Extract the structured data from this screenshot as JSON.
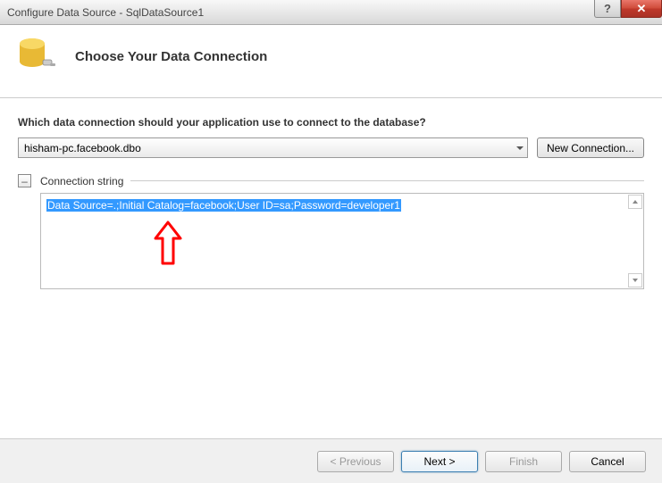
{
  "titlebar": {
    "title": "Configure Data Source - SqlDataSource1",
    "help_symbol": "?",
    "close_symbol": "✕"
  },
  "header": {
    "title": "Choose Your Data Connection"
  },
  "content": {
    "question": "Which data connection should your application use to connect to the database?",
    "selected_connection": "hisham-pc.facebook.dbo",
    "new_connection_label": "New Connection...",
    "expand_label": "Connection string",
    "expand_symbol": "–",
    "connection_string": "Data Source=.;Initial Catalog=facebook;User ID=sa;Password=developer1"
  },
  "footer": {
    "previous": "< Previous",
    "next": "Next >",
    "finish": "Finish",
    "cancel": "Cancel"
  }
}
